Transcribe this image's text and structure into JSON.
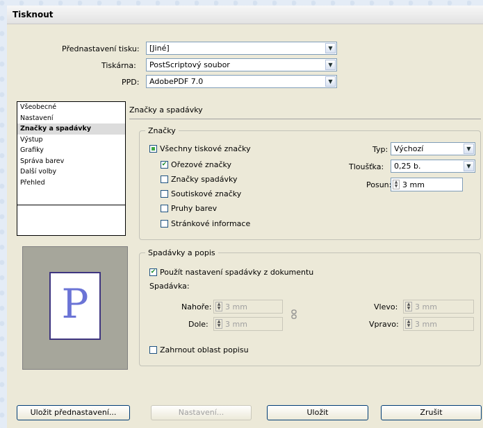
{
  "window": {
    "title": "Tisknout"
  },
  "header": {
    "preset_label": "Přednastavení tisku:",
    "preset_value": "[Jiné]",
    "printer_label": "Tiskárna:",
    "printer_value": "PostScriptový soubor",
    "ppd_label": "PPD:",
    "ppd_value": "AdobePDF 7.0"
  },
  "sidebar": {
    "items": [
      {
        "label": "Všeobecné"
      },
      {
        "label": "Nastavení"
      },
      {
        "label": "Značky a spadávky"
      },
      {
        "label": "Výstup"
      },
      {
        "label": "Grafiky"
      },
      {
        "label": "Správa barev"
      },
      {
        "label": "Další volby"
      },
      {
        "label": "Přehled"
      }
    ],
    "selected_index": 2
  },
  "preview": {
    "letter": "P"
  },
  "main": {
    "section_title": "Značky a spadávky",
    "marks": {
      "legend": "Značky",
      "all_marks": "Všechny tiskové značky",
      "crop_marks": "Ořezové značky",
      "bleed_marks": "Značky spadávky",
      "registration_marks": "Soutiskové značky",
      "color_bars": "Pruhy barev",
      "page_info": "Stránkové informace",
      "type_label": "Typ:",
      "type_value": "Výchozí",
      "weight_label": "Tloušťka:",
      "weight_value": "0,25 b.",
      "offset_label": "Posun:",
      "offset_value": "3 mm"
    },
    "bleed": {
      "legend": "Spadávky a popis",
      "use_doc": "Použít nastavení spadávky z dokumentu",
      "bleed_label": "Spadávka:",
      "top_label": "Nahoře:",
      "top_value": "3 mm",
      "bottom_label": "Dole:",
      "bottom_value": "3 mm",
      "left_label": "Vlevo:",
      "left_value": "3 mm",
      "right_label": "Vpravo:",
      "right_value": "3 mm",
      "slug": "Zahrnout oblast popisu"
    }
  },
  "footer": {
    "save_preset": "Uložit přednastavení...",
    "setup": "Nastavení...",
    "save": "Uložit",
    "cancel": "Zrušit"
  }
}
